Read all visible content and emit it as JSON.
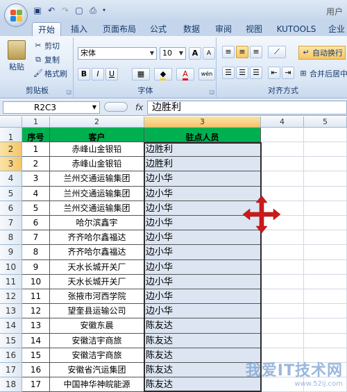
{
  "titlebar": {
    "title_partial": "用户"
  },
  "tabs": [
    "开始",
    "插入",
    "页面布局",
    "公式",
    "数据",
    "审阅",
    "视图",
    "KUTOOLS",
    "企业"
  ],
  "ribbon": {
    "clipboard": {
      "paste": "粘贴",
      "cut": "剪切",
      "copy": "复制",
      "format_painter": "格式刷",
      "label": "剪贴板"
    },
    "font": {
      "font_name": "宋体",
      "font_size": "10",
      "grow": "A",
      "shrink": "A",
      "bold": "B",
      "italic": "I",
      "underline": "U",
      "font_color": "A",
      "phonetic": "wén",
      "label": "字体"
    },
    "alignment": {
      "wrap_text": "自动换行",
      "merge_center": "合并后居中",
      "label": "对齐方式"
    }
  },
  "formula_bar": {
    "name_box": "R2C3",
    "fx": "fx",
    "content": "边胜利"
  },
  "columns": [
    "1",
    "2",
    "3",
    "4",
    "5"
  ],
  "header_row": {
    "row": "1",
    "c1": "序号",
    "c2": "客户",
    "c3": "驻点人员"
  },
  "rows": [
    {
      "row": "2",
      "c1": "1",
      "c2": "赤峰山金银铅",
      "c3": "边胜利"
    },
    {
      "row": "3",
      "c1": "2",
      "c2": "赤峰山金银铅",
      "c3": "边胜利"
    },
    {
      "row": "4",
      "c1": "3",
      "c2": "兰州交通运输集团",
      "c3": "边小华"
    },
    {
      "row": "5",
      "c1": "4",
      "c2": "兰州交通运输集团",
      "c3": "边小华"
    },
    {
      "row": "6",
      "c1": "5",
      "c2": "兰州交通运输集团",
      "c3": "边小华"
    },
    {
      "row": "7",
      "c1": "6",
      "c2": "哈尔滨鑫宇",
      "c3": "边小华"
    },
    {
      "row": "8",
      "c1": "7",
      "c2": "齐齐哈尔鑫福达",
      "c3": "边小华"
    },
    {
      "row": "9",
      "c1": "8",
      "c2": "齐齐哈尔鑫福达",
      "c3": "边小华"
    },
    {
      "row": "10",
      "c1": "9",
      "c2": "天水长城开关厂",
      "c3": "边小华"
    },
    {
      "row": "11",
      "c1": "10",
      "c2": "天水长城开关厂",
      "c3": "边小华"
    },
    {
      "row": "12",
      "c1": "11",
      "c2": "张掖市河西学院",
      "c3": "边小华"
    },
    {
      "row": "13",
      "c1": "12",
      "c2": "望奎县运输公司",
      "c3": "边小华"
    },
    {
      "row": "14",
      "c1": "13",
      "c2": "安徽东晨",
      "c3": "陈友达"
    },
    {
      "row": "15",
      "c1": "14",
      "c2": "安徽洁宇商旅",
      "c3": "陈友达"
    },
    {
      "row": "16",
      "c1": "15",
      "c2": "安徽洁宇商旅",
      "c3": "陈友达"
    },
    {
      "row": "17",
      "c1": "16",
      "c2": "安徽省汽运集团",
      "c3": "陈友达"
    },
    {
      "row": "18",
      "c1": "17",
      "c2": "中国神华神皖能源",
      "c3": "陈友达"
    }
  ],
  "watermark": {
    "main": "我爱IT技术网",
    "url": "www.52ij.com"
  },
  "colors": {
    "header_fill": "#00b050",
    "selection_fill": "#dce5f1",
    "move_cursor": "#cc1a1a"
  }
}
